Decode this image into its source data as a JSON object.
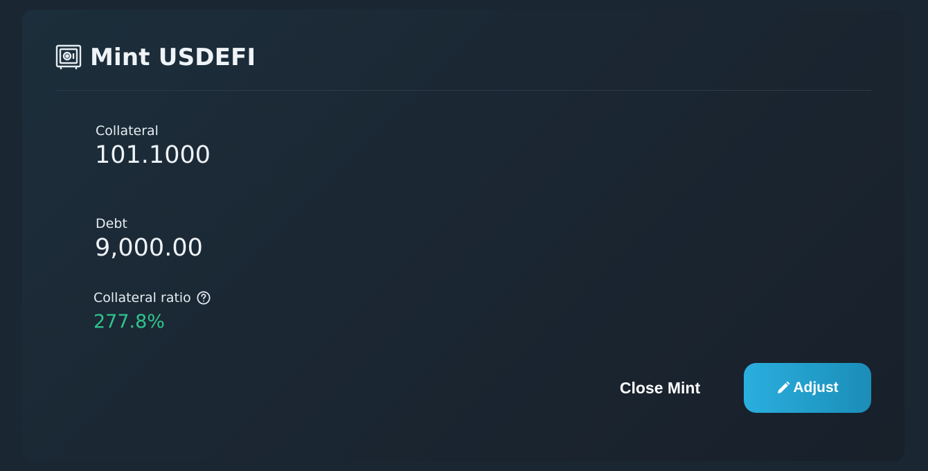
{
  "header": {
    "title": "Mint USDEFI",
    "icon": "safe-icon"
  },
  "stats": {
    "collateral": {
      "label": "Collateral",
      "value": "101.1000"
    },
    "debt": {
      "label": "Debt",
      "value": "9,000.00"
    },
    "ratio": {
      "label": "Collateral ratio",
      "value": "277.8%",
      "icon": "help-circle-icon"
    }
  },
  "actions": {
    "close_label": "Close Mint",
    "adjust_label": "Adjust",
    "adjust_icon": "pencil-icon"
  },
  "colors": {
    "ratio_healthy": "#2fc58e",
    "accent": "#2aafde"
  }
}
